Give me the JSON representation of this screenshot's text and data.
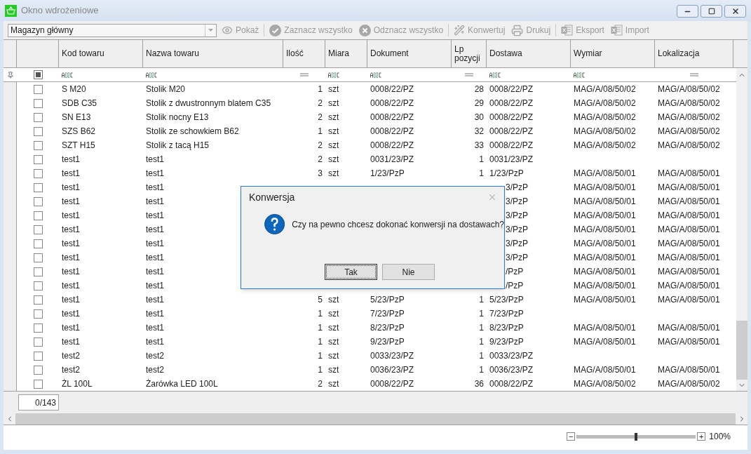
{
  "window": {
    "title": "Okno wdrożeniowe"
  },
  "toolbar": {
    "warehouse": "Magazyn główny",
    "buttons": [
      {
        "kind": "eye",
        "label": "Pokaż",
        "disabled": true
      },
      {
        "kind": "check",
        "label": "Zaznacz wszystko",
        "disabled": true
      },
      {
        "kind": "uncheck",
        "label": "Odznacz wszystko",
        "disabled": true
      },
      {
        "kind": "wand",
        "label": "Konwertuj",
        "disabled": true
      },
      {
        "kind": "print",
        "label": "Drukuj",
        "disabled": true
      },
      {
        "kind": "export",
        "label": "Eksport",
        "disabled": true
      },
      {
        "kind": "import",
        "label": "Import",
        "disabled": true
      }
    ]
  },
  "table": {
    "select_all_checked": true,
    "columns": [
      {
        "label": "Kod towaru",
        "kind": "text"
      },
      {
        "label": "Nazwa towaru",
        "kind": "text"
      },
      {
        "label": "Ilość",
        "kind": "number"
      },
      {
        "label": "Miara",
        "kind": "text"
      },
      {
        "label": "Dokument",
        "kind": "text"
      },
      {
        "label": "Lp pozycji",
        "kind": "number"
      },
      {
        "label": "Dostawa",
        "kind": "text"
      },
      {
        "label": "Wymiar",
        "kind": "text"
      },
      {
        "label": "Lokalizacja",
        "kind": "number"
      }
    ],
    "rows": [
      {
        "checked": false,
        "cells": [
          "S M20",
          "Stolik M20",
          "1",
          "szt",
          "0008/22/PZ",
          "28",
          "0008/22/PZ",
          "MAG/A/08/50/02",
          "MAG/A/08/50/02"
        ]
      },
      {
        "checked": false,
        "cells": [
          "SDB C35",
          "Stolik z dwustronnym blatem C35",
          "2",
          "szt",
          "0008/22/PZ",
          "29",
          "0008/22/PZ",
          "MAG/A/08/50/02",
          "MAG/A/08/50/02"
        ]
      },
      {
        "checked": false,
        "cells": [
          "SN E13",
          "Stolik nocny E13",
          "2",
          "szt",
          "0008/22/PZ",
          "30",
          "0008/22/PZ",
          "MAG/A/08/50/02",
          "MAG/A/08/50/02"
        ]
      },
      {
        "checked": false,
        "cells": [
          "SZS B62",
          "Stolik ze schowkiem B62",
          "1",
          "szt",
          "0008/22/PZ",
          "32",
          "0008/22/PZ",
          "MAG/A/08/50/02",
          "MAG/A/08/50/02"
        ]
      },
      {
        "checked": false,
        "cells": [
          "SZT H15",
          "Stolik z tacą H15",
          "2",
          "szt",
          "0008/22/PZ",
          "33",
          "0008/22/PZ",
          "MAG/A/08/50/02",
          "MAG/A/08/50/02"
        ]
      },
      {
        "checked": false,
        "cells": [
          "test1",
          "test1",
          "2",
          "szt",
          "0031/23/PZ",
          "1",
          "0031/23/PZ",
          null,
          null
        ]
      },
      {
        "checked": false,
        "cells": [
          "test1",
          "test1",
          "3",
          "szt",
          "1/23/PzP",
          "1",
          "1/23/PzP",
          "MAG/A/08/50/01",
          "MAG/A/08/50/01"
        ]
      },
      {
        "checked": false,
        "covered": true,
        "cells": [
          "test1",
          "test1",
          null,
          null,
          null,
          null,
          "3/PzP",
          "MAG/A/08/50/01",
          "MAG/A/08/50/01"
        ]
      },
      {
        "checked": false,
        "covered": true,
        "cells": [
          "test1",
          "test1",
          null,
          null,
          null,
          null,
          "3/PzP",
          "MAG/A/08/50/01",
          "MAG/A/08/50/01"
        ]
      },
      {
        "checked": false,
        "covered": true,
        "cells": [
          "test1",
          "test1",
          null,
          null,
          null,
          null,
          "3/PzP",
          "MAG/A/08/50/01",
          "MAG/A/08/50/01"
        ]
      },
      {
        "checked": false,
        "covered": true,
        "cells": [
          "test1",
          "test1",
          null,
          null,
          null,
          null,
          "3/PzP",
          "MAG/A/08/50/01",
          "MAG/A/08/50/01"
        ]
      },
      {
        "checked": false,
        "covered": true,
        "cells": [
          "test1",
          "test1",
          null,
          null,
          null,
          null,
          "3/PzP",
          "MAG/A/08/50/01",
          "MAG/A/08/50/01"
        ]
      },
      {
        "checked": false,
        "covered": true,
        "cells": [
          "test1",
          "test1",
          null,
          null,
          null,
          null,
          "3/PzP",
          "MAG/A/08/50/01",
          "MAG/A/08/50/01"
        ]
      },
      {
        "checked": false,
        "covered": true,
        "cells": [
          "test1",
          "test1",
          null,
          null,
          null,
          null,
          "/PzP",
          "MAG/A/08/50/01",
          "MAG/A/08/50/01"
        ]
      },
      {
        "checked": false,
        "covered": true,
        "cells": [
          "test1",
          "test1",
          null,
          null,
          null,
          null,
          "/PzP",
          "MAG/A/08/50/01",
          "MAG/A/08/50/01"
        ]
      },
      {
        "checked": false,
        "cells": [
          "test1",
          "test1",
          "5",
          "szt",
          "5/23/PzP",
          "1",
          "5/23/PzP",
          "MAG/A/08/50/01",
          "MAG/A/08/50/01"
        ]
      },
      {
        "checked": false,
        "cells": [
          "test1",
          "test1",
          "1",
          "szt",
          "7/23/PzP",
          "1",
          "7/23/PzP",
          null,
          null
        ]
      },
      {
        "checked": false,
        "cells": [
          "test1",
          "test1",
          "1",
          "szt",
          "8/23/PzP",
          "1",
          "8/23/PzP",
          "MAG/A/08/50/01",
          "MAG/A/08/50/01"
        ]
      },
      {
        "checked": false,
        "cells": [
          "test1",
          "test1",
          "1",
          "szt",
          "9/23/PzP",
          "1",
          "9/23/PzP",
          "MAG/A/08/50/01",
          "MAG/A/08/50/01"
        ]
      },
      {
        "checked": false,
        "cells": [
          "test2",
          "test2",
          "1",
          "szt",
          "0033/23/PZ",
          "1",
          "0033/23/PZ",
          null,
          null
        ]
      },
      {
        "checked": false,
        "cells": [
          "test2",
          "test2",
          "1",
          "szt",
          "0036/23/PZ",
          "1",
          "0036/23/PZ",
          "MAG/A/08/50/01",
          "MAG/A/08/50/01"
        ]
      },
      {
        "checked": false,
        "cells": [
          "ŻL 100L",
          "Żarówka LED 100L",
          "2",
          "szt",
          "0008/22/PZ",
          "36",
          "0008/22/PZ",
          "MAG/A/08/50/02",
          "MAG/A/08/50/02"
        ]
      }
    ]
  },
  "footer": {
    "counter": "0/143"
  },
  "zoom": {
    "level": 0.5,
    "minus": "−",
    "plus": "+",
    "reading": "100%"
  },
  "dialog": {
    "title": "Konwersja",
    "message": "Czy na pewno chcesz dokonać konwersji na dostawach?",
    "buttons": [
      {
        "label": "Tak",
        "focused": true
      },
      {
        "label": "Nie",
        "focused": false
      }
    ]
  }
}
